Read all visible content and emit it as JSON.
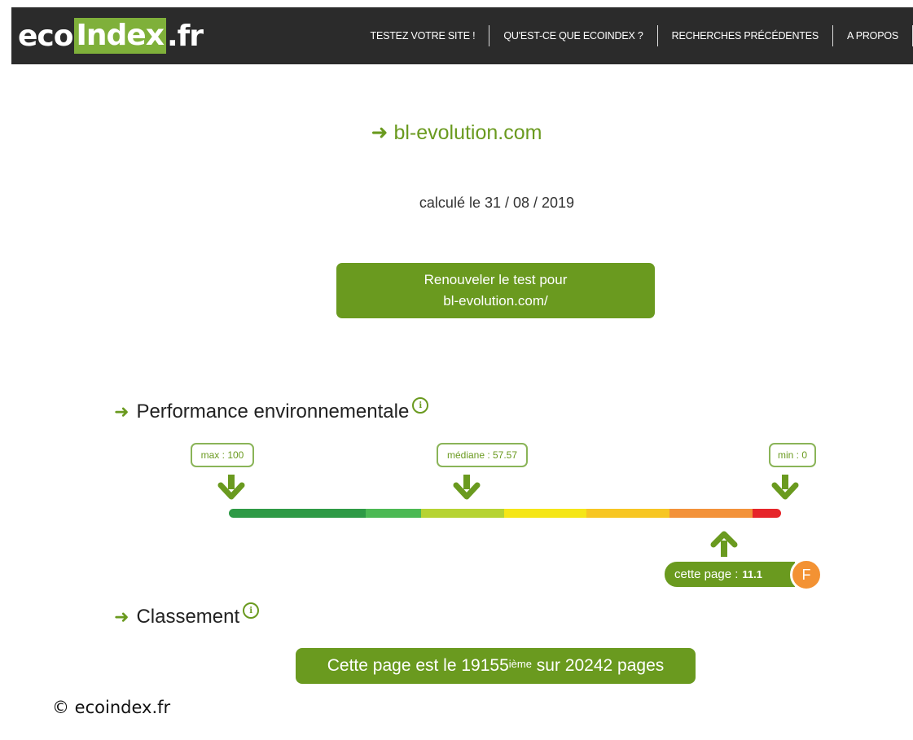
{
  "header": {
    "logo": {
      "left": "eco",
      "mid": "Index",
      "right": ".fr"
    },
    "nav": [
      {
        "label": "TESTEZ VOTRE SITE !"
      },
      {
        "label": "QU'EST-CE QUE ECOINDEX ?"
      },
      {
        "label": "RECHERCHES PRÉCÉDENTES"
      },
      {
        "label": "A PROPOS"
      }
    ]
  },
  "result": {
    "site": "bl-evolution.com",
    "computed_date": "calculé le 31 / 08 / 2019",
    "renew_line1": "Renouveler le test pour",
    "renew_line2": "bl-evolution.com/"
  },
  "performance": {
    "title": "Performance environnementale",
    "max_label": "max : 100",
    "median_label": "médiane : 57.57",
    "min_label": "min : 0",
    "scale_colors": [
      "#2e9a46",
      "#4cb954",
      "#b6d333",
      "#f5e617",
      "#f7c623",
      "#f3923a",
      "#e6252a"
    ],
    "page_label": "cette page :",
    "page_score": "11.1",
    "grade": "F",
    "grade_color": "#f39233"
  },
  "ranking": {
    "title": "Classement",
    "prefix": "Cette page est le 19155",
    "suffix_sup": "ième",
    "rest": " sur 20242 pages"
  },
  "footer": {
    "copyright": "© ecoindex.fr"
  },
  "colors": {
    "brand_green": "#6a9a1f",
    "header_bg": "#2b2b2b"
  }
}
